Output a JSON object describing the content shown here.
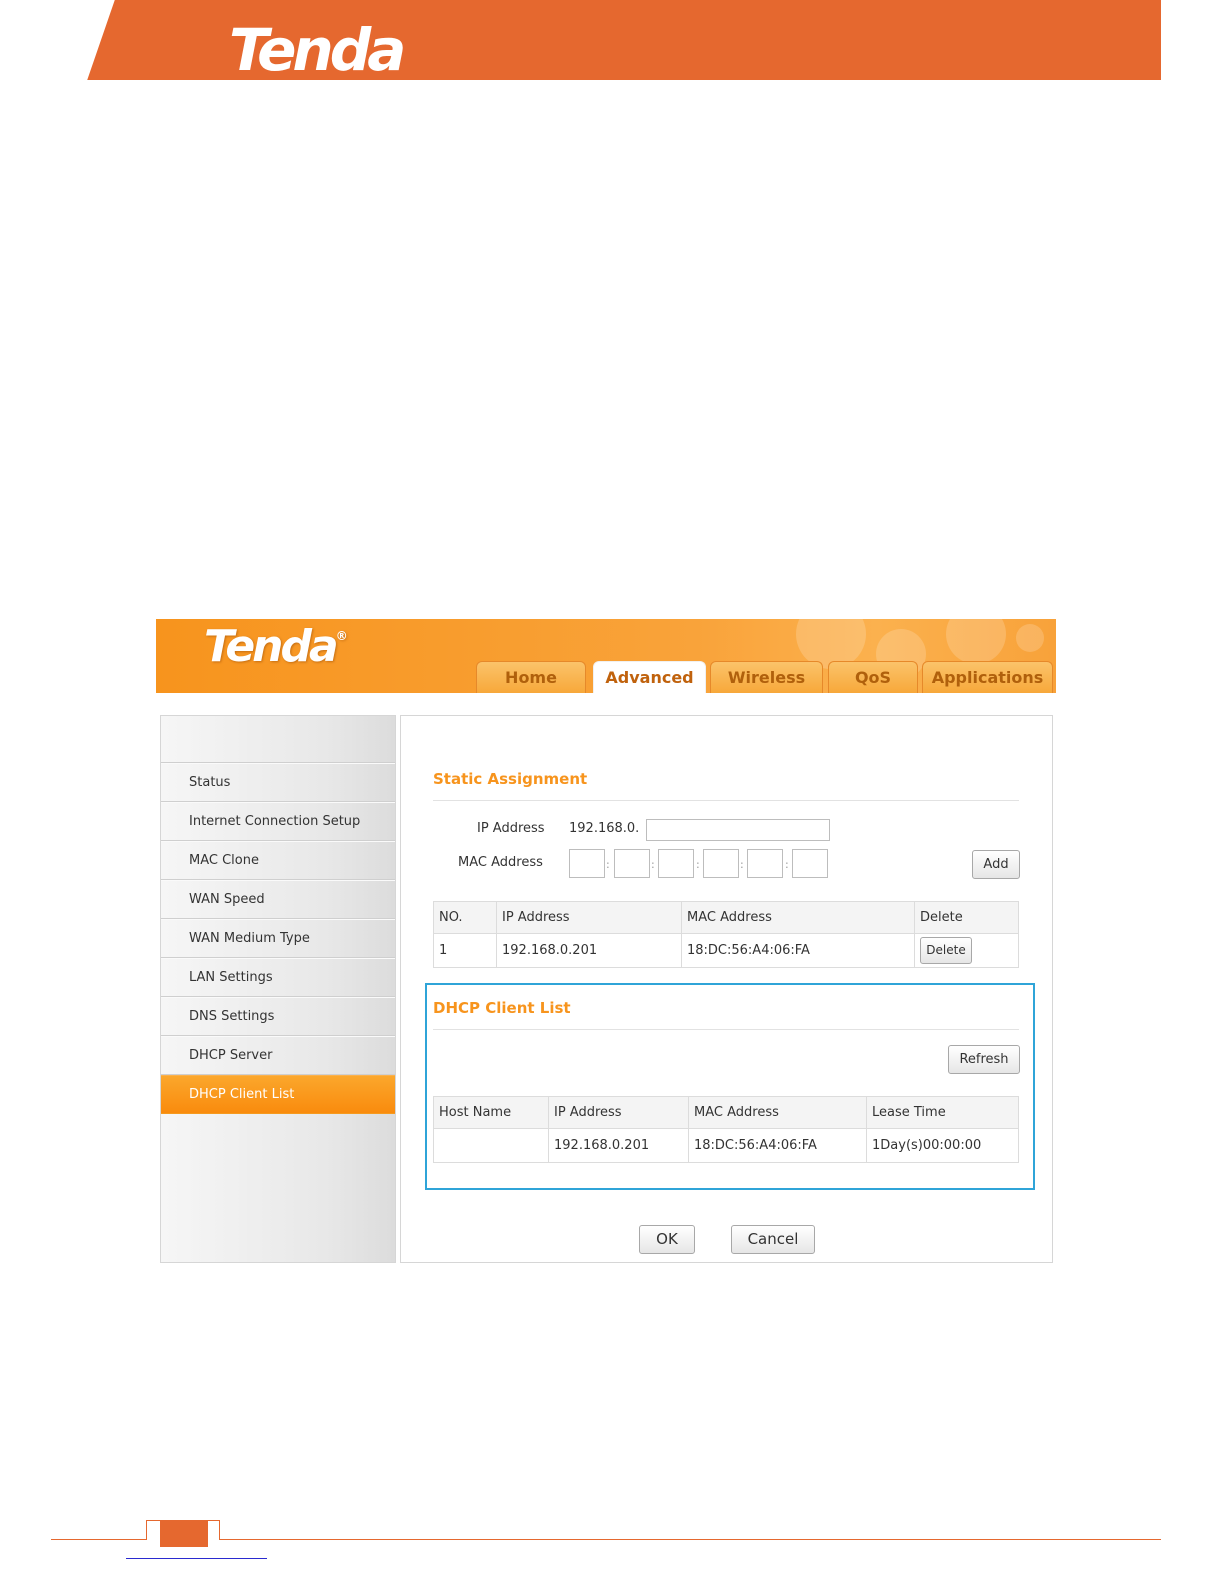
{
  "document": {
    "logo_text": "Tenda"
  },
  "ui_header": {
    "logo_text": "Tenda",
    "logo_mark": "®",
    "tabs": [
      {
        "label": "Home",
        "active": false
      },
      {
        "label": "Advanced",
        "active": true
      },
      {
        "label": "Wireless",
        "active": false
      },
      {
        "label": "QoS",
        "active": false
      },
      {
        "label": "Applications",
        "active": false
      }
    ]
  },
  "sidebar": {
    "items": [
      {
        "label": "Status",
        "active": false
      },
      {
        "label": "Internet Connection Setup",
        "active": false
      },
      {
        "label": "MAC Clone",
        "active": false
      },
      {
        "label": "WAN Speed",
        "active": false
      },
      {
        "label": "WAN Medium Type",
        "active": false
      },
      {
        "label": "LAN Settings",
        "active": false
      },
      {
        "label": "DNS Settings",
        "active": false
      },
      {
        "label": "DHCP Server",
        "active": false
      },
      {
        "label": "DHCP Client List",
        "active": true
      }
    ]
  },
  "static_assignment": {
    "title": "Static Assignment",
    "ip_label": "IP Address",
    "ip_prefix": "192.168.0.",
    "ip_value": "",
    "mac_label": "MAC Address",
    "mac_separator": ":",
    "add_label": "Add",
    "table": {
      "headers": [
        "NO.",
        "IP Address",
        "MAC Address",
        "Delete"
      ],
      "rows": [
        {
          "no": "1",
          "ip": "192.168.0.201",
          "mac": "18:DC:56:A4:06:FA",
          "delete_label": "Delete"
        }
      ]
    }
  },
  "dhcp_client_list": {
    "title": "DHCP Client List",
    "refresh_label": "Refresh",
    "table": {
      "headers": [
        "Host Name",
        "IP Address",
        "MAC Address",
        "Lease Time"
      ],
      "rows": [
        {
          "host": "",
          "ip": "192.168.0.201",
          "mac": "18:DC:56:A4:06:FA",
          "lease": "1Day(s)00:00:00"
        }
      ]
    }
  },
  "actions": {
    "ok_label": "OK",
    "cancel_label": "Cancel"
  },
  "colors": {
    "document_accent": "#e5682f",
    "ui_orange": "#f7941d",
    "highlight_border": "#2fa4d8"
  }
}
